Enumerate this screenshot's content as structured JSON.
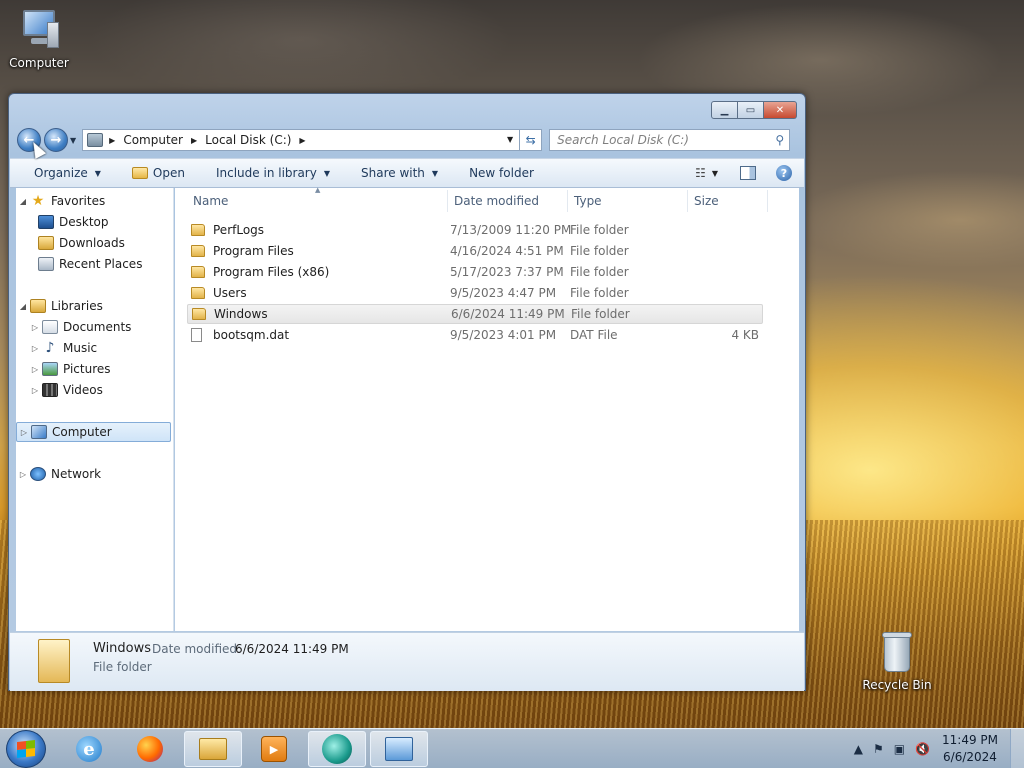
{
  "desktop": {
    "icons": [
      {
        "label": "Computer"
      },
      {
        "label": "Recycle Bin"
      }
    ]
  },
  "window": {
    "controls": {
      "minimize": "▁",
      "maximize": "▭",
      "close": "✕"
    },
    "address": {
      "crumbs": [
        "Computer",
        "Local Disk (C:)"
      ]
    },
    "search": {
      "placeholder": "Search Local Disk (C:)"
    },
    "toolbar": {
      "organize": "Organize",
      "open": "Open",
      "include_in_library": "Include in library",
      "share_with": "Share with",
      "new_folder": "New folder"
    },
    "nav_pane": {
      "favorites": {
        "label": "Favorites",
        "items": [
          "Desktop",
          "Downloads",
          "Recent Places"
        ]
      },
      "libraries": {
        "label": "Libraries",
        "items": [
          "Documents",
          "Music",
          "Pictures",
          "Videos"
        ]
      },
      "computer": "Computer",
      "network": "Network"
    },
    "columns": {
      "name": "Name",
      "date": "Date modified",
      "type": "Type",
      "size": "Size"
    },
    "files": [
      {
        "name": "PerfLogs",
        "date": "7/13/2009 11:20 PM",
        "type": "File folder",
        "size": "",
        "kind": "folder"
      },
      {
        "name": "Program Files",
        "date": "4/16/2024 4:51 PM",
        "type": "File folder",
        "size": "",
        "kind": "folder"
      },
      {
        "name": "Program Files (x86)",
        "date": "5/17/2023 7:37 PM",
        "type": "File folder",
        "size": "",
        "kind": "folder"
      },
      {
        "name": "Users",
        "date": "9/5/2023 4:47 PM",
        "type": "File folder",
        "size": "",
        "kind": "folder"
      },
      {
        "name": "Windows",
        "date": "6/6/2024 11:49 PM",
        "type": "File folder",
        "size": "",
        "kind": "folder"
      },
      {
        "name": "bootsqm.dat",
        "date": "9/5/2023 4:01 PM",
        "type": "DAT File",
        "size": "4 KB",
        "kind": "file"
      }
    ],
    "details": {
      "name": "Windows",
      "date_label": "Date modified:",
      "date": "6/6/2024 11:49 PM",
      "type": "File folder"
    }
  },
  "taskbar": {
    "apps": [
      "start",
      "internet-explorer",
      "firefox",
      "windows-explorer",
      "media-player",
      "screen-app",
      "remote-desktop"
    ],
    "clock": {
      "time": "11:49 PM",
      "date": "6/6/2024"
    }
  }
}
